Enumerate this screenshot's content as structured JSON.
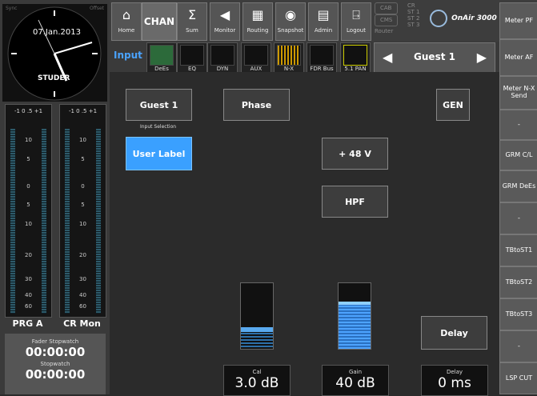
{
  "clock": {
    "date": "07.Jan.2013",
    "brand": "STUDER",
    "corner_left": "Sync",
    "corner_right": "Offset"
  },
  "meters": {
    "scale": "-1 0 .5 +1",
    "ticks": [
      "10",
      "5",
      "0",
      "5",
      "10",
      "20",
      "30",
      "40",
      "60"
    ],
    "left_label": "PRG A",
    "right_label": "CR Mon"
  },
  "stopwatch": {
    "fader_label": "Fader Stopwatch",
    "fader_value": "00:00:00",
    "label": "Stopwatch",
    "value": "00:00:00"
  },
  "nav": {
    "home": "Home",
    "chan": "CHAN",
    "sum": "Sum",
    "monitor": "Monitor",
    "routing": "Routing",
    "snapshot": "Snapshot",
    "admin": "Admin",
    "logout": "Logout",
    "cab": "CAB",
    "cms": "CMS",
    "router": "Router",
    "cr": "CR",
    "st1": "ST 1",
    "st2": "ST 2",
    "st3": "ST 3",
    "onair": "OnAir 3000"
  },
  "row2": {
    "input": "Input",
    "dees": "DeEs",
    "eq": "EQ",
    "dyn": "DYN",
    "aux": "AUX",
    "nx": "N-X",
    "fdrbus": "FDR Bus",
    "pan": "5.1 PAN",
    "guest": "Guest 1"
  },
  "side": [
    "Meter PF",
    "Meter AF",
    "Meter N-X Send",
    "-",
    "GRM C/L",
    "GRM DeEs",
    "-",
    "TBtoST1",
    "TBtoST2",
    "TBtoST3",
    "-",
    "LSP CUT"
  ],
  "main": {
    "guest_btn": "Guest 1",
    "input_selection": "Input Selection",
    "user_label": "User Label",
    "phase": "Phase",
    "gen": "GEN",
    "phantom": "+ 48 V",
    "hpf": "HPF",
    "delay_btn": "Delay",
    "cal_label": "Cal",
    "cal_value": "3.0 dB",
    "gain_label": "Gain",
    "gain_value": "40 dB",
    "delay_label": "Delay",
    "delay_value": "0 ms"
  },
  "faders": {
    "cal_level": 0.55,
    "gain_level": 0.72
  }
}
